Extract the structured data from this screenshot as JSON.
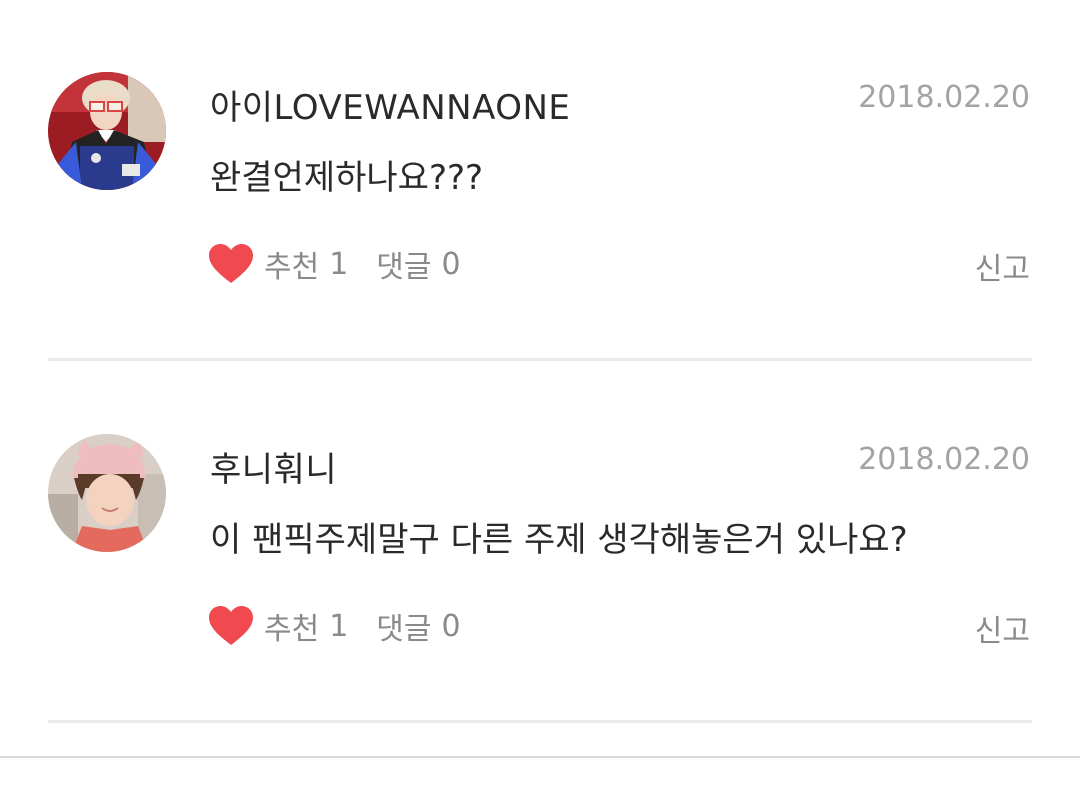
{
  "comments": [
    {
      "author": "아이LOVEWANNAONE",
      "date": "2018.02.20",
      "text": "완결언제하나요???",
      "like_label": "추천",
      "like_count": "1",
      "reply_label": "댓글",
      "reply_count": "0",
      "report_label": "신고"
    },
    {
      "author": "후니훠니",
      "date": "2018.02.20",
      "text": "이 팬픽주제말구 다른 주제 생각해놓은거 있나요?",
      "like_label": "추천",
      "like_count": "1",
      "reply_label": "댓글",
      "reply_count": "0",
      "report_label": "신고"
    }
  ],
  "colors": {
    "heart": "#f0494f",
    "date": "#a3a3a3",
    "action_text": "#8a8a8a",
    "divider": "#ebebeb"
  },
  "icons": {
    "like": "heart-icon"
  }
}
